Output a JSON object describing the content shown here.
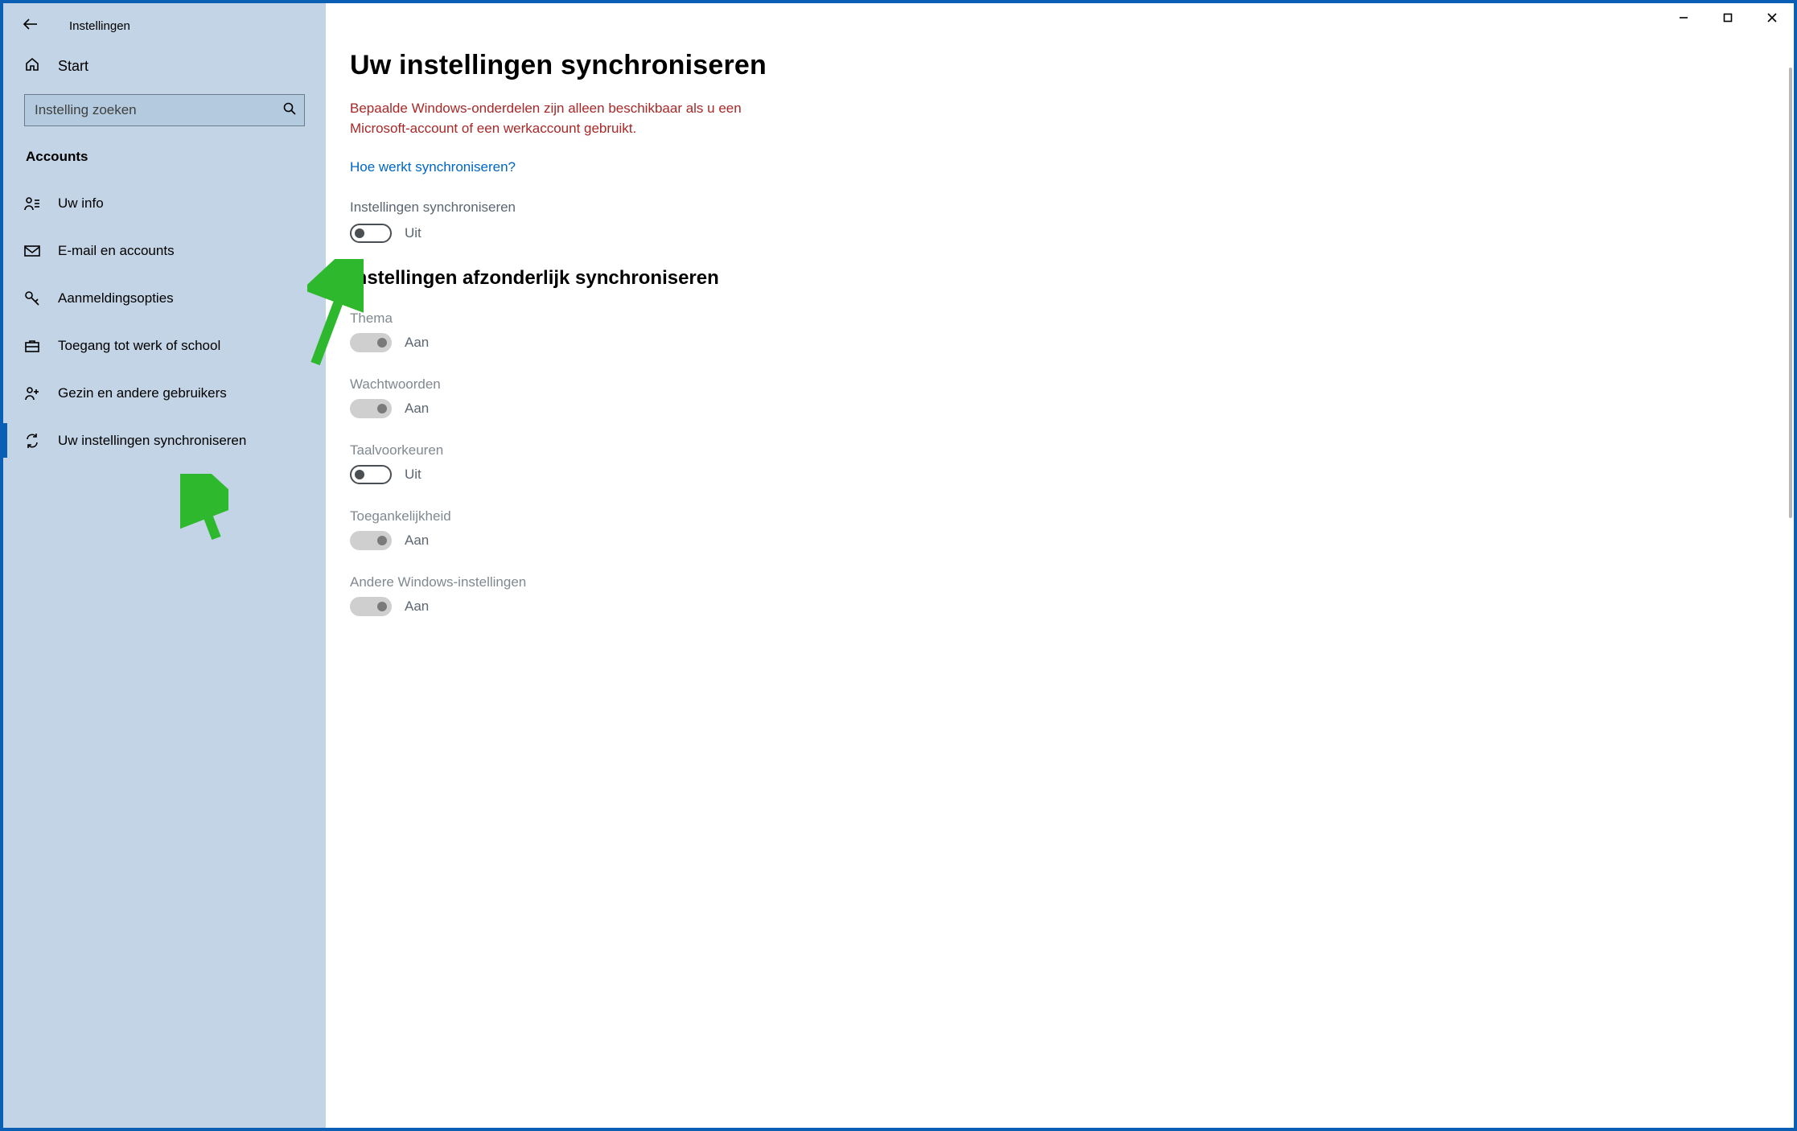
{
  "app_title": "Instellingen",
  "sidebar": {
    "home": "Start",
    "search_placeholder": "Instelling zoeken",
    "section": "Accounts",
    "items": [
      {
        "label": "Uw info"
      },
      {
        "label": "E-mail en accounts"
      },
      {
        "label": "Aanmeldingsopties"
      },
      {
        "label": "Toegang tot werk of school"
      },
      {
        "label": "Gezin en andere gebruikers"
      },
      {
        "label": "Uw instellingen synchroniseren"
      }
    ]
  },
  "page": {
    "title": "Uw instellingen synchroniseren",
    "alert": "Bepaalde Windows-onderdelen zijn alleen beschikbaar als u een Microsoft-account of een werkaccount gebruikt.",
    "help_link": "Hoe werkt synchroniseren?",
    "master": {
      "label": "Instellingen synchroniseren",
      "state": "Uit"
    },
    "sub_title": "Instellingen afzonderlijk synchroniseren",
    "settings": [
      {
        "label": "Thema",
        "state": "Aan",
        "disabled": true,
        "on": true
      },
      {
        "label": "Wachtwoorden",
        "state": "Aan",
        "disabled": true,
        "on": true
      },
      {
        "label": "Taalvoorkeuren",
        "state": "Uit",
        "disabled": false,
        "on": false
      },
      {
        "label": "Toegankelijkheid",
        "state": "Aan",
        "disabled": true,
        "on": true
      },
      {
        "label": "Andere Windows-instellingen",
        "state": "Aan",
        "disabled": true,
        "on": true
      }
    ]
  }
}
